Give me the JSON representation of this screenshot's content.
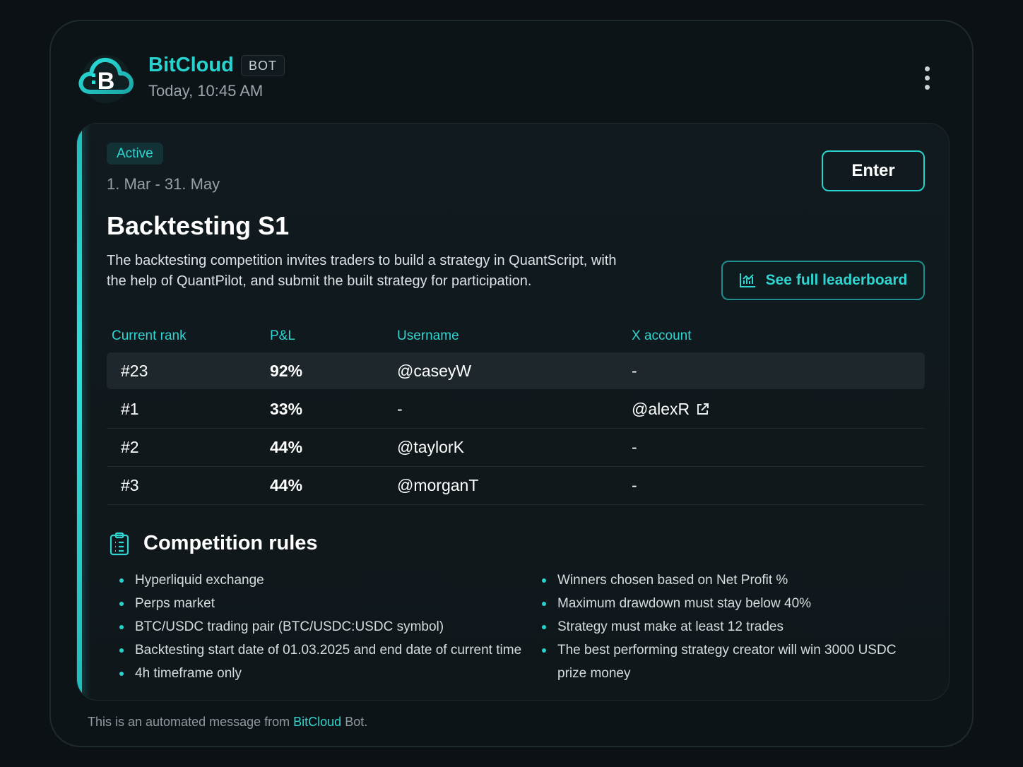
{
  "sender": {
    "name": "BitCloud",
    "badge": "BOT",
    "timestamp": "Today, 10:45 AM"
  },
  "card": {
    "status": "Active",
    "date_range": "1. Mar - 31. May",
    "enter_label": "Enter",
    "title": "Backtesting S1",
    "description": "The backtesting competition invites traders to build a strategy in QuantScript, with the help of QuantPilot, and submit the built strategy for participation.",
    "leaderboard_label": "See full leaderboard",
    "table": {
      "headers": [
        "Current rank",
        "P&L",
        "Username",
        "X account"
      ],
      "rows": [
        {
          "rank": "#23",
          "pnl": "92%",
          "username": "@caseyW",
          "x_account": "-",
          "highlighted": true
        },
        {
          "rank": "#1",
          "pnl": "33%",
          "username": "-",
          "x_account": "@alexR",
          "x_link": true
        },
        {
          "rank": "#2",
          "pnl": "44%",
          "username": "@taylorK",
          "x_account": "-"
        },
        {
          "rank": "#3",
          "pnl": "44%",
          "username": "@morganT",
          "x_account": "-"
        }
      ]
    },
    "rules": {
      "title": "Competition rules",
      "left": [
        "Hyperliquid exchange",
        "Perps market",
        "BTC/USDC trading pair (BTC/USDC:USDC symbol)",
        "Backtesting start date of 01.03.2025 and end date of current time",
        "4h timeframe only"
      ],
      "right": [
        "Winners chosen based on Net Profit %",
        "Maximum drawdown must stay below 40%",
        "Strategy must make at least 12 trades",
        "The best performing strategy creator will win 3000 USDC prize money"
      ]
    }
  },
  "footer": {
    "prefix": "This is an automated message from ",
    "brand": "BitCloud",
    "suffix": " Bot."
  },
  "colors": {
    "accent": "#27d3cf",
    "background": "#0b1114",
    "card": "#111a1e"
  },
  "icons": {
    "avatar": "bitcloud-logo-icon",
    "menu": "kebab-menu-icon",
    "leaderboard": "chart-icon",
    "external": "external-link-icon",
    "rules": "clipboard-icon"
  }
}
